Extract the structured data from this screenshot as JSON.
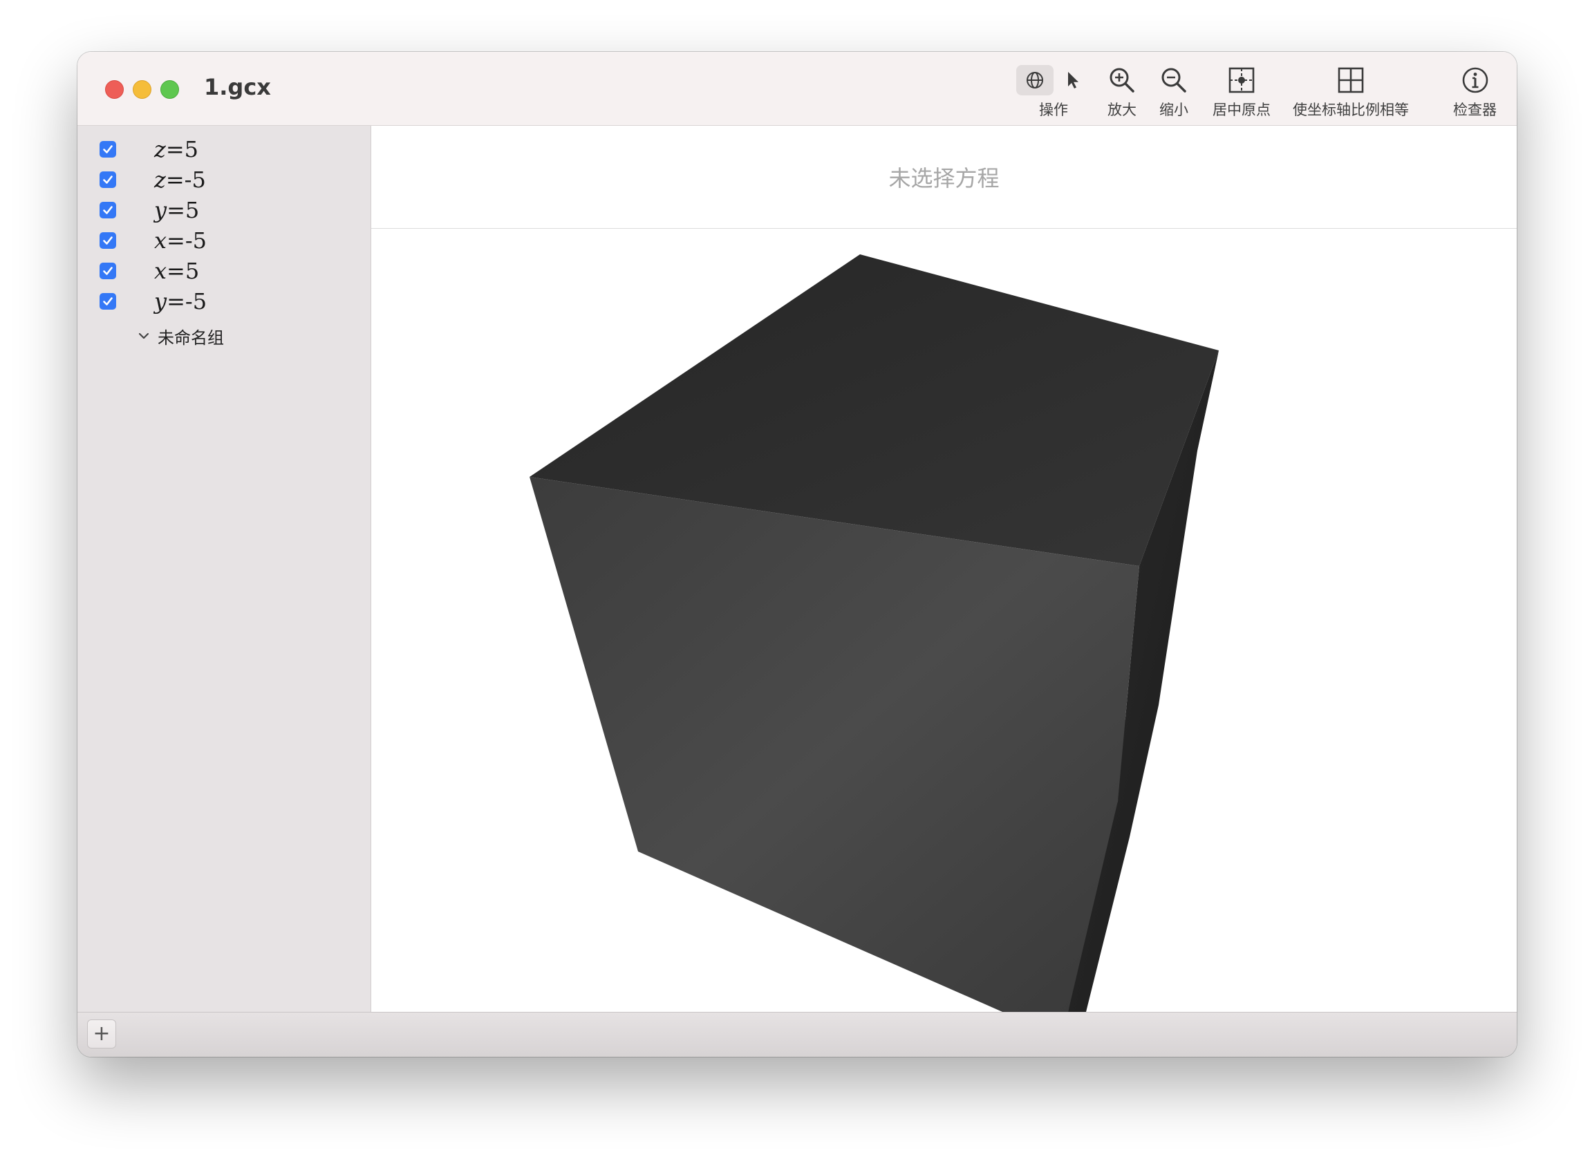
{
  "window": {
    "title": "1.gcx"
  },
  "toolbar": {
    "mode_label": "操作",
    "zoom_in_label": "放大",
    "zoom_out_label": "缩小",
    "center_origin_label": "居中原点",
    "equal_axes_label": "使坐标轴比例相等",
    "inspector_label": "检查器"
  },
  "sidebar": {
    "equations": [
      {
        "var": "z",
        "rest": "=5",
        "checked": true
      },
      {
        "var": "z",
        "rest": "=-5",
        "checked": true
      },
      {
        "var": "y",
        "rest": "=5",
        "checked": true
      },
      {
        "var": "x",
        "rest": "=-5",
        "checked": true
      },
      {
        "var": "x",
        "rest": "=5",
        "checked": true
      },
      {
        "var": "y",
        "rest": "=-5",
        "checked": true
      }
    ],
    "group_label": "未命名组"
  },
  "main": {
    "equation_placeholder": "未选择方程"
  },
  "footer": {
    "add_label": "+"
  },
  "colors": {
    "accent": "#3478f6",
    "close": "#ee5e57",
    "minimize": "#f5bd3a",
    "maximize": "#5ec74f"
  }
}
